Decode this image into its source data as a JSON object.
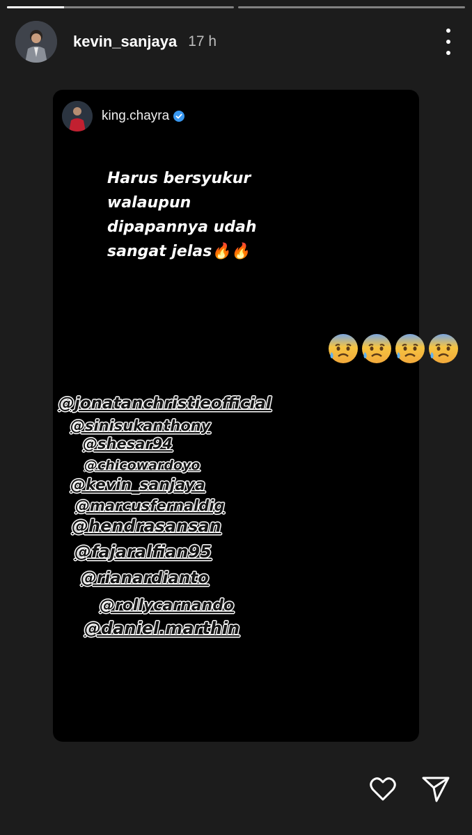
{
  "progress": [
    1,
    0
  ],
  "progress_fill": [
    0.25,
    0
  ],
  "header": {
    "username": "kevin_sanjaya",
    "time_ago": "17 h"
  },
  "shared_post": {
    "username": "king.chayra",
    "caption_lines": [
      "Harus bersyukur",
      "walaupun",
      "dipapannya udah",
      "sangat jelas🔥🔥"
    ],
    "tags": [
      "@jonatanchristieofficial",
      "@sinisukanthony",
      "@shesar94",
      "@chicowardoyo",
      "@kevin_sanjaya",
      "@marcusfernaldig",
      "@hendrasansan",
      "@fajaralfian95",
      "@rianardianto",
      "@rollycarnando",
      "@daniel.marthin"
    ]
  },
  "sticker": {
    "emoji": "anxious-face-with-sweat",
    "count": 4
  },
  "actions": {
    "like_icon": "heart-icon",
    "share_icon": "send-icon"
  },
  "colors": {
    "background": "#1c1c1c",
    "card": "#000000",
    "verified": "#3897f0"
  }
}
